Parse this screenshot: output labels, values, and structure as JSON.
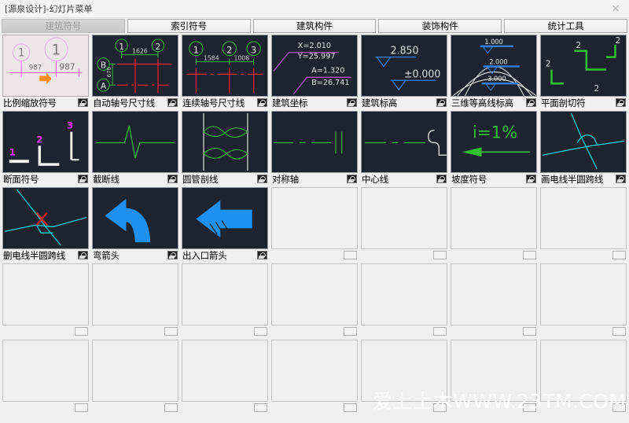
{
  "window": {
    "title": "[源泉设计]-幻灯片菜单",
    "close_label": "×"
  },
  "tabs": [
    {
      "label": "建筑符号",
      "active": true
    },
    {
      "label": "索引符号",
      "active": false
    },
    {
      "label": "建筑构件",
      "active": false
    },
    {
      "label": "装饰构件",
      "active": false
    },
    {
      "label": "统计工具",
      "active": false
    }
  ],
  "cells": [
    {
      "label": "比例缩放符号",
      "art": "scale",
      "empty": false,
      "light": true
    },
    {
      "label": "自动轴号尺寸线",
      "art": "axis-auto",
      "empty": false,
      "light": false
    },
    {
      "label": "连续轴号尺寸线",
      "art": "axis-cont",
      "empty": false,
      "light": false
    },
    {
      "label": "建筑坐标",
      "art": "coord",
      "empty": false,
      "light": false
    },
    {
      "label": "建筑标高",
      "art": "elev",
      "empty": false,
      "light": false
    },
    {
      "label": "三维等高线标高",
      "art": "contour",
      "empty": false,
      "light": false
    },
    {
      "label": "平面剖切符",
      "art": "section-plan",
      "empty": false,
      "light": false
    },
    {
      "label": "断面符号",
      "art": "section-sym",
      "empty": false,
      "light": false
    },
    {
      "label": "截断线",
      "art": "break-line",
      "empty": false,
      "light": false
    },
    {
      "label": "圆管剖线",
      "art": "pipe-break",
      "empty": false,
      "light": false
    },
    {
      "label": "对称轴",
      "art": "symmetry",
      "empty": false,
      "light": false
    },
    {
      "label": "中心线",
      "art": "centerline",
      "empty": false,
      "light": false
    },
    {
      "label": "坡度符号",
      "art": "slope",
      "empty": false,
      "light": false
    },
    {
      "label": "画电线半圆跨线",
      "art": "wire-hop",
      "empty": false,
      "light": false
    },
    {
      "label": "删电线半圆跨线",
      "art": "wire-del",
      "empty": false,
      "light": false
    },
    {
      "label": "弯箭头",
      "art": "curve-arrow",
      "empty": false,
      "light": false
    },
    {
      "label": "出入口箭头",
      "art": "entry-arrow",
      "empty": false,
      "light": false
    },
    {
      "label": "",
      "art": "",
      "empty": true,
      "light": false
    },
    {
      "label": "",
      "art": "",
      "empty": true,
      "light": false
    },
    {
      "label": "",
      "art": "",
      "empty": true,
      "light": false
    },
    {
      "label": "",
      "art": "",
      "empty": true,
      "light": false
    },
    {
      "label": "",
      "art": "",
      "empty": true,
      "light": false
    },
    {
      "label": "",
      "art": "",
      "empty": true,
      "light": false
    },
    {
      "label": "",
      "art": "",
      "empty": true,
      "light": false
    },
    {
      "label": "",
      "art": "",
      "empty": true,
      "light": false
    },
    {
      "label": "",
      "art": "",
      "empty": true,
      "light": false
    },
    {
      "label": "",
      "art": "",
      "empty": true,
      "light": false
    },
    {
      "label": "",
      "art": "",
      "empty": true,
      "light": false
    },
    {
      "label": "",
      "art": "",
      "empty": true,
      "light": false
    },
    {
      "label": "",
      "art": "",
      "empty": true,
      "light": false
    },
    {
      "label": "",
      "art": "",
      "empty": true,
      "light": false
    },
    {
      "label": "",
      "art": "",
      "empty": true,
      "light": false
    },
    {
      "label": "",
      "art": "",
      "empty": true,
      "light": false
    },
    {
      "label": "",
      "art": "",
      "empty": true,
      "light": false
    },
    {
      "label": "",
      "art": "",
      "empty": true,
      "light": false
    }
  ],
  "thumb_text": {
    "scale": {
      "n1": "1",
      "n2": "1",
      "d1": "987",
      "d2": "987"
    },
    "axis_auto": {
      "a": "1",
      "b": "2",
      "dim": "1626",
      "rowB": "B",
      "rowA": "A",
      "vdim": "676"
    },
    "axis_cont": {
      "a": "1",
      "b": "2",
      "c": "3",
      "d1": "1584",
      "d2": "1008"
    },
    "coord": {
      "x": "X=2.010",
      "y": "Y=25.997",
      "a": "A=1.320",
      "b": "B=26.741"
    },
    "elev": {
      "top": "2.850",
      "bottom": "±0.000"
    },
    "contour": {
      "l1": "1.000",
      "l2": "2.000",
      "l3": "3.000"
    },
    "section_plan": {
      "n1": "2",
      "n2": "2",
      "n3": "2",
      "n4": "2"
    },
    "section_sym": {
      "n1": "1",
      "n2": "2",
      "n3": "3"
    },
    "slope": {
      "text": "i=1%"
    }
  },
  "watermark": "爱上土木WWW.23TM.COM",
  "colors": {
    "thumb_bg": "#1d2430",
    "green": "#2fbf2f",
    "magenta": "#ff00ff",
    "cyan": "#00e5e5",
    "blue": "#1f7fe0",
    "white": "#f0f0f0",
    "red": "#ff0000",
    "purple": "#b44ecf"
  }
}
